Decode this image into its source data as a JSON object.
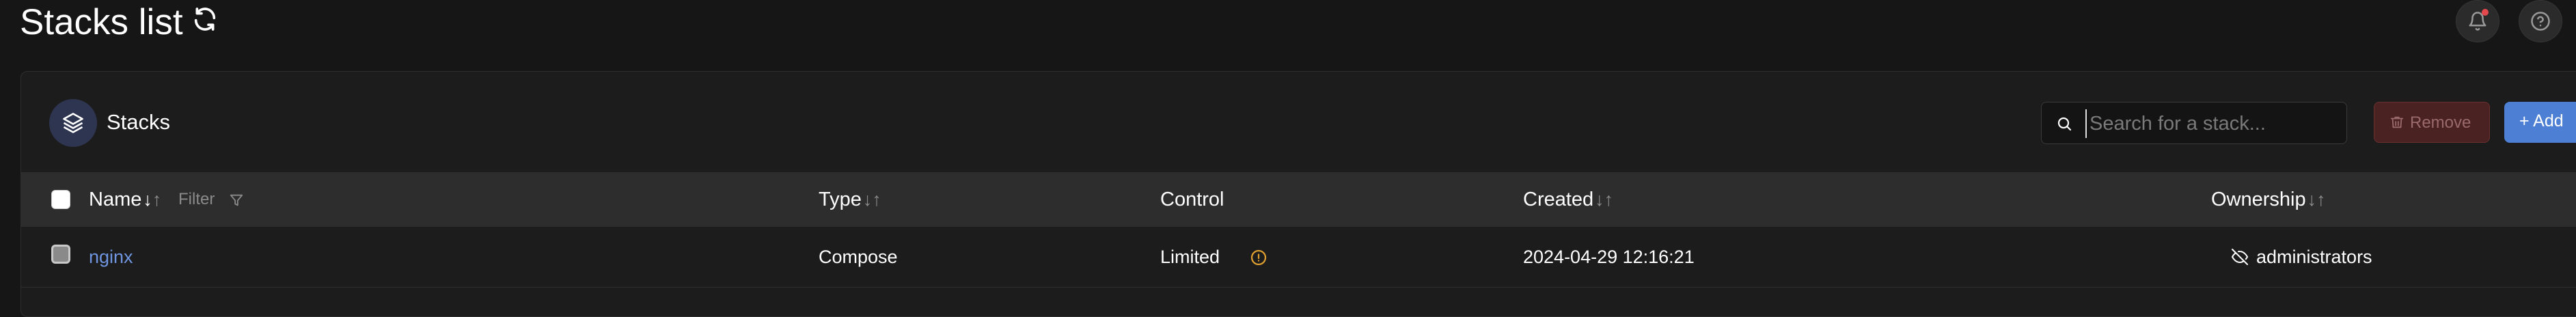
{
  "header": {
    "title": "Stacks list"
  },
  "widget": {
    "title": "Stacks",
    "search": {
      "placeholder": "Search for a stack...",
      "value": ""
    },
    "remove_label": "Remove",
    "add_label": "+ Add"
  },
  "table": {
    "columns": [
      {
        "label": "Name",
        "sort": "↓↑"
      },
      {
        "label": "Type",
        "sort": "↓↑"
      },
      {
        "label": "Control"
      },
      {
        "label": "Created",
        "sort": "↓↑"
      },
      {
        "label": "Ownership",
        "sort": "↓↑"
      }
    ],
    "filter_label": "Filter",
    "rows": [
      {
        "name": "nginx",
        "type": "Compose",
        "control": "Limited",
        "created": "2024-04-29 12:16:21",
        "ownership": "administrators"
      }
    ]
  },
  "colors": {
    "accent": "#4d7fd4",
    "link": "#6f95e0",
    "danger": "#4a2222",
    "warning": "#e0a030",
    "notification": "#e5484d"
  },
  "icons": [
    "refresh-icon",
    "bell-icon",
    "help-icon",
    "stacks-icon",
    "search-icon",
    "trash-icon",
    "filter-icon",
    "info-icon",
    "eye-off-icon"
  ]
}
